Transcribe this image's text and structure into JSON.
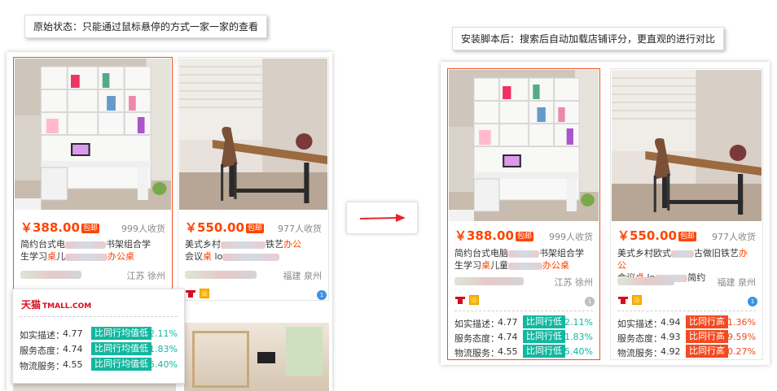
{
  "left_caption": "原始状态：只能通过鼠标悬停的方式一家一家的查看",
  "right_caption": "安装脚本后：搜索后自动加载店铺评分，更直观的进行对比",
  "colors": {
    "price": "#ff4400",
    "lower": "#13b7a0",
    "higher": "#f34a21",
    "arrow": "#e8252a"
  },
  "left": {
    "product1": {
      "price": "￥388.00",
      "badge": "包邮",
      "sales": "999人收货",
      "title_a": "简约台式电",
      "title_b": "书架组合学",
      "title_c": "生学习",
      "title_hl1": "桌",
      "title_d": "儿",
      "title_hl2": "办公桌",
      "location": "江苏 徐州"
    },
    "product2": {
      "price": "￥550.00",
      "badge": "包邮",
      "sales": "977人收货",
      "title_a": "美式乡村",
      "title_b": "铁艺",
      "title_hl1": "办公",
      "title_c": "会议",
      "title_hl2": "桌",
      "title_d": "lo",
      "location": "福建 泉州"
    },
    "popup": {
      "brand": "天猫",
      "brand_en": "TMALL.COM",
      "rows": [
        {
          "label": "如实描述：",
          "score": "4.77",
          "compare": "比同行均值低",
          "percent": "2.11%"
        },
        {
          "label": "服务态度：",
          "score": "4.74",
          "compare": "比同行均值低",
          "percent": "1.83%"
        },
        {
          "label": "物流服务：",
          "score": "4.55",
          "compare": "比同行均值低",
          "percent": "5.40%"
        }
      ]
    }
  },
  "right": {
    "product1": {
      "price": "￥388.00",
      "badge": "包邮",
      "sales": "999人收货",
      "title_a": "简约台式电脑",
      "title_b": "书架组合学",
      "title_c": "生学习",
      "title_hl1": "桌",
      "title_d": "儿童",
      "title_hl2": "办公桌",
      "location": "江苏 徐州",
      "rows": [
        {
          "label": "如实描述：",
          "score": "4.77",
          "compare": "比同行低",
          "percent": "2.11%",
          "dir": "low"
        },
        {
          "label": "服务态度：",
          "score": "4.74",
          "compare": "比同行低",
          "percent": "1.83%",
          "dir": "low"
        },
        {
          "label": "物流服务：",
          "score": "4.55",
          "compare": "比同行低",
          "percent": "5.40%",
          "dir": "low"
        }
      ]
    },
    "product2": {
      "price": "￥550.00",
      "badge": "包邮",
      "sales": "977人收货",
      "title_a": "美式乡村欧式",
      "title_b": "古做旧铁艺",
      "title_hl1": "办公",
      "title_c": "会议",
      "title_hl2": "桌",
      "title_d": "lo",
      "title_e": "简约",
      "location": "福建 泉州",
      "rows": [
        {
          "label": "如实描述：",
          "score": "4.94",
          "compare": "比同行高",
          "percent": "51.36%",
          "dir": "high"
        },
        {
          "label": "服务态度：",
          "score": "4.93",
          "compare": "比同行高",
          "percent": "59.59%",
          "dir": "high"
        },
        {
          "label": "物流服务：",
          "score": "4.92",
          "compare": "比同行高",
          "percent": "60.27%",
          "dir": "high"
        }
      ]
    }
  }
}
